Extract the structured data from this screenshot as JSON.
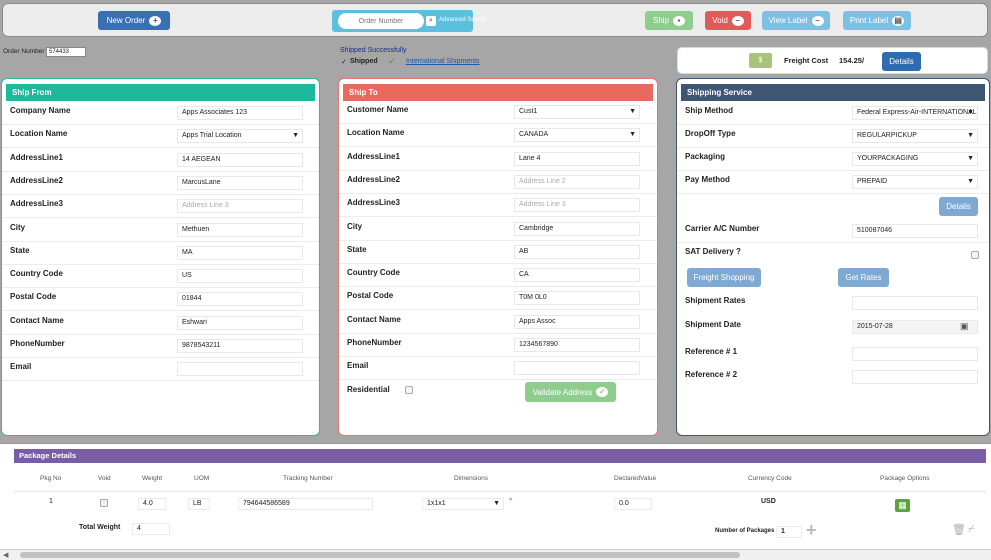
{
  "toolbar": {
    "new_order": "New Order",
    "order_number_placeholder": "Order Number",
    "advanced_search": "Advanced Search",
    "ship": "Ship",
    "void": "Void",
    "view_label": "View Label",
    "print_label": "Print Label"
  },
  "status": {
    "order_number_label": "Order Number",
    "order_number_value": "574433",
    "shipped_successfully": "Shipped Successfully",
    "shipped": "Shipped",
    "international_shipments": "International Shipments"
  },
  "freight": {
    "label": "Freight Cost",
    "value": "154.25/",
    "details": "Details"
  },
  "ship_from": {
    "title": "Ship From",
    "rows": [
      {
        "label": "Company Name",
        "value": "Apps Associates 123"
      },
      {
        "label": "Location Name",
        "value": "Apps Trial Location"
      },
      {
        "label": "AddressLine1",
        "value": "14 AEGEAN"
      },
      {
        "label": "AddressLine2",
        "value": "MarcusLane"
      },
      {
        "label": "AddressLine3",
        "value": "",
        "placeholder": "Address Line 3"
      },
      {
        "label": "City",
        "value": "Methuen"
      },
      {
        "label": "State",
        "value": "MA"
      },
      {
        "label": "Country Code",
        "value": "US"
      },
      {
        "label": "Postal Code",
        "value": "01844"
      },
      {
        "label": "Contact Name",
        "value": "Eshwari"
      },
      {
        "label": "PhoneNumber",
        "value": "9878543211"
      },
      {
        "label": "Email",
        "value": ""
      }
    ]
  },
  "ship_to": {
    "title": "Ship To",
    "rows": [
      {
        "label": "Customer Name",
        "value": "Cust1"
      },
      {
        "label": "Location Name",
        "value": "CANADA"
      },
      {
        "label": "AddressLine1",
        "value": "Lane 4"
      },
      {
        "label": "AddressLine2",
        "value": "",
        "placeholder": "Address Line 2"
      },
      {
        "label": "AddressLine3",
        "value": "",
        "placeholder": "Address Line 3"
      },
      {
        "label": "City",
        "value": "Cambridge"
      },
      {
        "label": "State",
        "value": "AB"
      },
      {
        "label": "Country Code",
        "value": "CA"
      },
      {
        "label": "Postal Code",
        "value": "T0M 0L0"
      },
      {
        "label": "Contact Name",
        "value": "Apps Assoc"
      },
      {
        "label": "PhoneNumber",
        "value": "1234567890"
      },
      {
        "label": "Email",
        "value": ""
      },
      {
        "label": "Residential",
        "value": ""
      }
    ],
    "validate": "Validate Address"
  },
  "shipping_service": {
    "title": "Shipping Service",
    "rows": [
      {
        "label": "Ship Method",
        "value": "Federal Express-Air-INTERNATIONAL"
      },
      {
        "label": "DropOff Type",
        "value": "REGULARPICKUP"
      },
      {
        "label": "Packaging",
        "value": "YOURPACKAGING"
      },
      {
        "label": "Pay Method",
        "value": "PREPAID"
      }
    ],
    "details": "Details",
    "carrier_label": "Carrier A/C Number",
    "carrier_value": "510087046",
    "sat_label": "SAT Delivery ?",
    "freight_shopping": "Freight Shopping",
    "get_rates": "Get Rates",
    "rates_label": "Shipment Rates",
    "date_label": "Shipment Date",
    "date_value": "2015-07-28",
    "ref1_label": "Reference # 1",
    "ref2_label": "Reference # 2"
  },
  "package": {
    "title": "Package Details",
    "headers": [
      "Pkg No",
      "Void",
      "Weight",
      "UOM",
      "Tracking Number",
      "Dimensions",
      "DeclaredValue",
      "Currency Code",
      "Package Options"
    ],
    "row": {
      "pkg_no": "1",
      "weight": "4.0",
      "uom": "LB",
      "tracking": "794644586589",
      "dimensions": "1x1x1",
      "declared": "0.0",
      "currency": "USD"
    },
    "total_weight_label": "Total Weight",
    "total_weight": "4",
    "num_packages_label": "Number of Packages",
    "num_packages": "1"
  }
}
